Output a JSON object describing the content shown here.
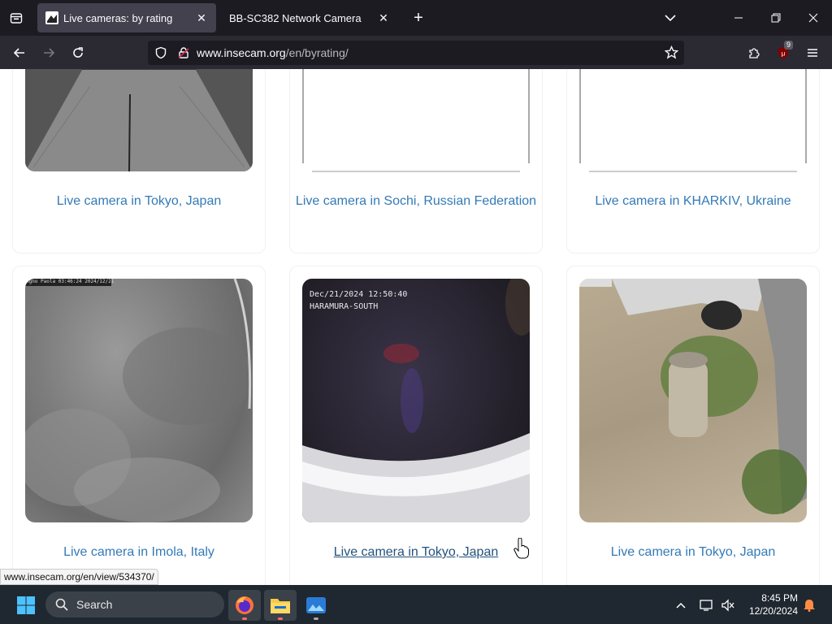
{
  "browser": {
    "tabs": [
      {
        "title": "Live cameras: by rating",
        "active": true
      },
      {
        "title": "BB-SC382 Network Camera",
        "active": false
      }
    ],
    "url_host": "www.insecam.org",
    "url_path": "/en/byrating/",
    "extension_badge": "9"
  },
  "cards_row1": [
    {
      "caption": "Live camera in Tokyo, Japan"
    },
    {
      "caption": "Live camera in Sochi, Russian Federation"
    },
    {
      "caption": "Live camera in KHARKIV, Ukraine"
    }
  ],
  "cards_row2": [
    {
      "caption": "Live camera in Imola, Italy",
      "overlay": "Agno Paola 03:46:24 2024/12/21"
    },
    {
      "caption": "Live camera in Tokyo, Japan",
      "overlay_line1": "Dec/21/2024 12:50:40",
      "overlay_line2": "HARAMURA-SOUTH"
    },
    {
      "caption": "Live camera in Tokyo, Japan"
    }
  ],
  "status_url": "www.insecam.org/en/view/534370/",
  "taskbar": {
    "search_label": "Search",
    "time": "8:45 PM",
    "date": "12/20/2024"
  },
  "colors": {
    "link": "#337ab7",
    "tabstrip": "#1c1b22",
    "toolbar": "#2b2a33"
  }
}
